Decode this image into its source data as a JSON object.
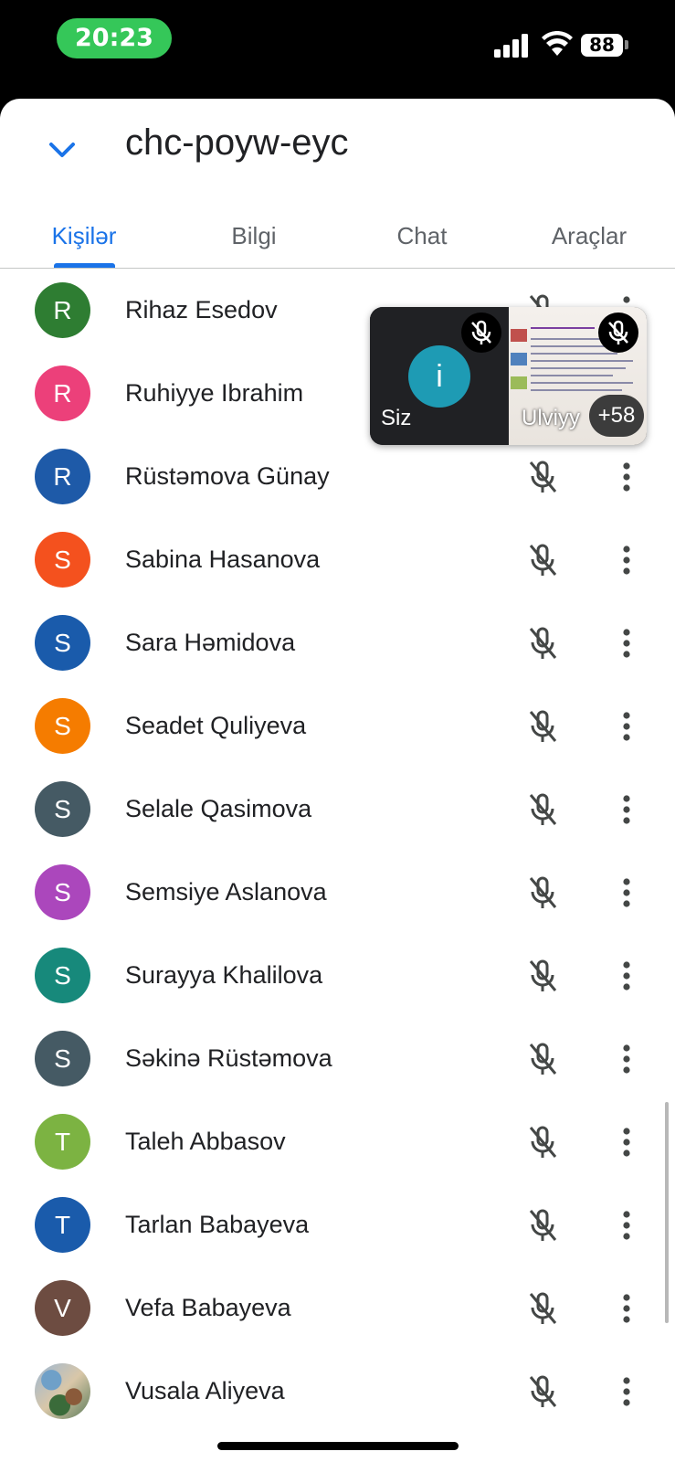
{
  "status_bar": {
    "time": "20:23",
    "battery": "88"
  },
  "header": {
    "meeting_code": "chc-poyw-eyc"
  },
  "tabs": [
    {
      "label": "Kişilər",
      "active": true
    },
    {
      "label": "Bilgi",
      "active": false
    },
    {
      "label": "Chat",
      "active": false
    },
    {
      "label": "Araçlar",
      "active": false
    }
  ],
  "participants": [
    {
      "initial": "R",
      "name": "Rihaz Esedov",
      "color": "#2e7d32",
      "muted": true
    },
    {
      "initial": "R",
      "name": "Ruhiyye Ibrahim",
      "color": "#ec407a",
      "muted": true
    },
    {
      "initial": "R",
      "name": "Rüstəmova Günay",
      "color": "#1e5aa8",
      "muted": true
    },
    {
      "initial": "S",
      "name": "Sabina Hasanova",
      "color": "#f4511e",
      "muted": true
    },
    {
      "initial": "S",
      "name": "Sara Həmidova",
      "color": "#1a5bab",
      "muted": true
    },
    {
      "initial": "S",
      "name": "Seadet Quliyeva",
      "color": "#f57c00",
      "muted": true
    },
    {
      "initial": "S",
      "name": "Selale Qasimova",
      "color": "#455a64",
      "muted": true
    },
    {
      "initial": "S",
      "name": "Semsiye Aslanova",
      "color": "#ab47bc",
      "muted": true
    },
    {
      "initial": "S",
      "name": "Surayya Khalilova",
      "color": "#17897b",
      "muted": true
    },
    {
      "initial": "S",
      "name": "Səkinə Rüstəmova",
      "color": "#455a64",
      "muted": true
    },
    {
      "initial": "T",
      "name": "Taleh Abbasov",
      "color": "#7cb342",
      "muted": true
    },
    {
      "initial": "T",
      "name": "Tarlan Babayeva",
      "color": "#1a5bab",
      "muted": true
    },
    {
      "initial": "V",
      "name": "Vefa Babayeva",
      "color": "#6d4c41",
      "muted": true
    },
    {
      "initial": "",
      "name": "Vusala Aliyeva",
      "color": "",
      "photo": true,
      "muted": true
    }
  ],
  "pip": {
    "self": {
      "initial": "i",
      "label": "Siz"
    },
    "presenter": {
      "label": "Ulviyy"
    },
    "more_count": "+58"
  }
}
